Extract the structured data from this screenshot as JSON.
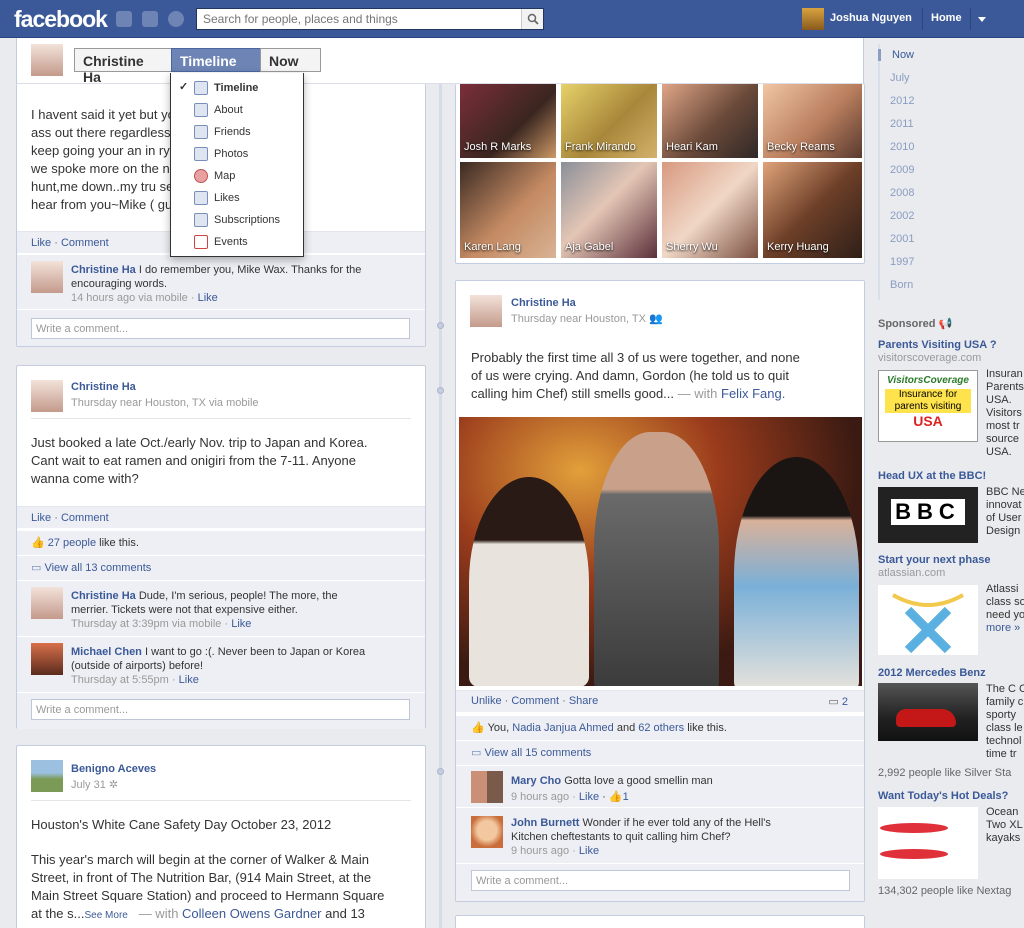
{
  "topbar": {
    "logo": "facebook",
    "search_placeholder": "Search for people, places and things",
    "user_name": "Joshua Nguyen",
    "home_label": "Home"
  },
  "timeline_header": {
    "name_button": "Christine Ha",
    "timeline_button": "Timeline",
    "now_button": "Now"
  },
  "dropdown": {
    "items": [
      "Timeline",
      "About",
      "Friends",
      "Photos",
      "Map",
      "Likes",
      "Subscriptions",
      "Events"
    ]
  },
  "post1": {
    "text_lines": [
      "I havent said it yet but you kick royal",
      "ass out there regardless o hinder you,you",
      "keep going your an in rywhere I wish",
      "we spoke more on the new york",
      "hunt,me down..my tru serving hope to",
      "hear from you~Mike ( guy)"
    ],
    "like": "Like",
    "comment": "Comment",
    "comment_author": "Christine Ha",
    "comment_text_1": "I do remember you, Mike Wax. Thanks for the",
    "comment_text_2": "encouraging words.",
    "comment_meta": "14 hours ago via mobile",
    "comment_like": "Like",
    "comment_placeholder": "Write a comment..."
  },
  "post2": {
    "author": "Christine Ha",
    "meta": "Thursday near Houston, TX via mobile",
    "text_lines": [
      "Just booked a late Oct./early Nov. trip to Japan and Korea.",
      "Cant wait to eat ramen and onigiri from the 7-11. Anyone",
      "wanna come with?"
    ],
    "like": "Like",
    "comment": "Comment",
    "likes_count": "27 people",
    "likes_suffix": "like this.",
    "view_all": "View all 13 comments",
    "c1_author": "Christine Ha",
    "c1_text_1": "Dude, I'm serious, people! The more, the",
    "c1_text_2": "merrier. Tickets were not that expensive either.",
    "c1_meta": "Thursday at 3:39pm via mobile",
    "c1_like": "Like",
    "c2_author": "Michael Chen",
    "c2_text_1": "I want to go :(. Never been to Japan or Korea",
    "c2_text_2": "(outside of airports) before!",
    "c2_meta": "Thursday at 5:55pm",
    "c2_like": "Like",
    "comment_placeholder": "Write a comment..."
  },
  "post3": {
    "author": "Benigno Aceves",
    "meta": "July 31",
    "title": "Houston's White Cane Safety Day October 23, 2012",
    "text_lines": [
      "This year's march will begin at the corner of Walker & Main",
      "Street, in front of The Nutrition Bar, (914 Main Street, at the",
      "Main Street Square Station) and proceed to Hermann Square"
    ],
    "last_line_start": "at the s...",
    "see_more": "See More",
    "with_text": "— with",
    "with_name": "Colleen Owens Gardner",
    "and_text": "and 13"
  },
  "friends_grid": {
    "row1": [
      "Josh R Marks",
      "Frank Mirando",
      "Heari Kam",
      "Becky Reams"
    ],
    "row2": [
      "Karen Lang",
      "Aja Gabel",
      "Sherry Wu",
      "Kerry Huang"
    ]
  },
  "post4": {
    "author": "Christine Ha",
    "meta": "Thursday near Houston, TX",
    "text_lines": [
      "Probably the first time all 3 of us were together, and none",
      "of us were crying. And damn, Gordon (he told us to quit"
    ],
    "line3_start": "calling him Chef) still smells good...",
    "with_text": "— with",
    "with_name": "Felix Fang.",
    "unlike": "Unlike",
    "comment": "Comment",
    "share": "Share",
    "comment_count": "2",
    "likes_you": "You,",
    "likes_name": "Nadia Janjua Ahmed",
    "likes_and": "and",
    "likes_others": "62 others",
    "likes_suffix": "like this.",
    "view_all": "View all 15 comments",
    "c1_author": "Mary Cho",
    "c1_text": "Gotta love a good smellin man",
    "c1_meta": "9 hours ago",
    "c1_like": "Like",
    "c1_likes": "1",
    "c2_author": "John Burnett",
    "c2_text_1": "Wonder if he ever told any of the Hell's",
    "c2_text_2": "Kitchen cheftestants to quit calling him Chef?",
    "c2_meta": "9 hours ago",
    "c2_like": "Like",
    "comment_placeholder": "Write a comment..."
  },
  "timeline_years": [
    "Now",
    "July",
    "2012",
    "2011",
    "2010",
    "2009",
    "2008",
    "2002",
    "2001",
    "1997",
    "Born"
  ],
  "sponsored": {
    "label": "Sponsored",
    "ads": [
      {
        "title": "Parents Visiting USA ?",
        "sub": "visitorscoverage.com",
        "img_line1": "VisitorsCoverage",
        "img_line2": "Insurance for",
        "img_line3": "parents visiting",
        "img_line4": "USA",
        "text": [
          "Insuran",
          "Parents",
          "USA.",
          "Visitors",
          "most tr",
          "source",
          "USA."
        ]
      },
      {
        "title": "Head UX at the BBC!",
        "img_text": "BBC",
        "text": [
          "BBC Ne",
          "innovat",
          "of User",
          "Design"
        ]
      },
      {
        "title": "Start your next phase",
        "sub": "atlassian.com",
        "text": [
          "Atlassi",
          "class so",
          "need yo",
          "more »"
        ]
      },
      {
        "title": "2012 Mercedes Benz",
        "text": [
          "The C C",
          "family c",
          "sporty",
          "class le",
          "technol",
          "time tr"
        ],
        "likes": "2,992 people like Silver Sta"
      },
      {
        "title": "Want Today's Hot Deals?",
        "text": [
          "Ocean",
          "Two XL",
          "kayaks"
        ],
        "likes": "134,302 people like Nextag"
      }
    ]
  },
  "colors": {
    "brand": "#3b5998",
    "timeline_active": "#6d84b4",
    "background": "#e9ebee"
  }
}
